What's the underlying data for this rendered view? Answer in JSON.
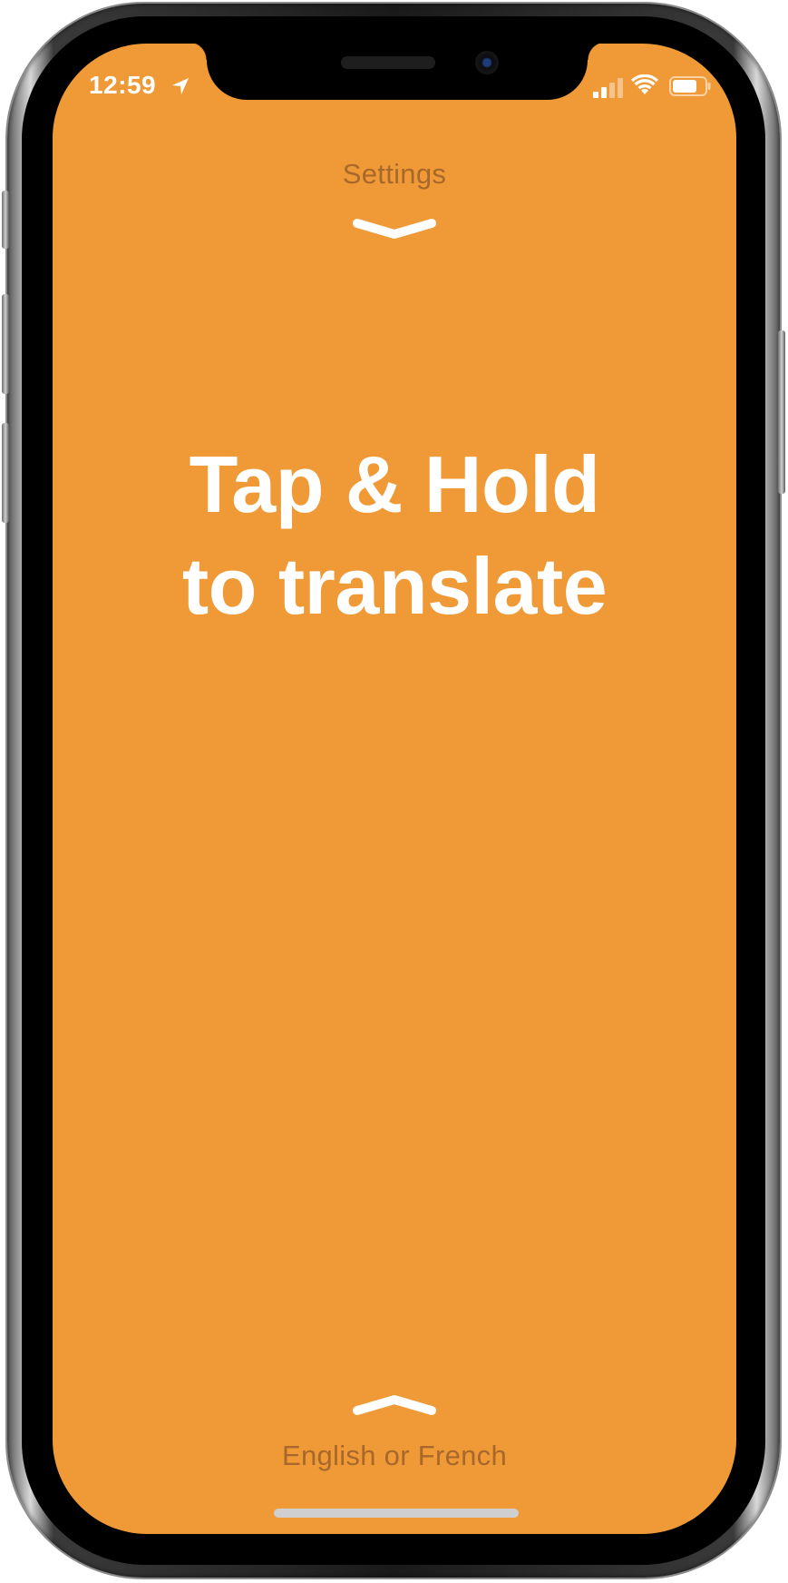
{
  "status_bar": {
    "time": "12:59",
    "icons": [
      "location-arrow-icon",
      "cellular-signal-icon",
      "wifi-icon",
      "battery-icon"
    ]
  },
  "settings": {
    "label": "Settings",
    "icon": "chevron-down-icon"
  },
  "main": {
    "title_line1": "Tap & Hold",
    "title_line2": "to translate"
  },
  "language": {
    "label": "English or French",
    "icon": "chevron-up-icon"
  },
  "colors": {
    "background": "#ef9a37",
    "hint_text": "#a8682b",
    "title_text": "#ffffff"
  }
}
